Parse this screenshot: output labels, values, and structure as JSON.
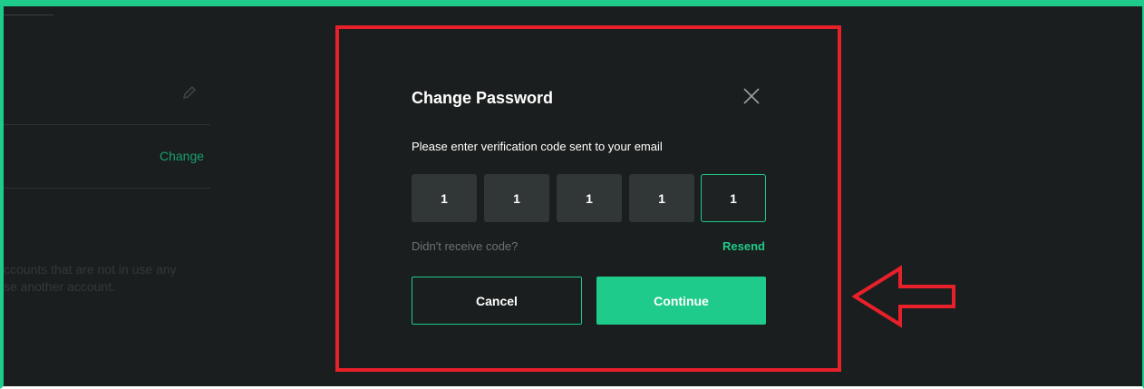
{
  "background": {
    "change_link": "Change",
    "note_line_1": "ccounts that are not in use any",
    "note_line_2": "se another account."
  },
  "modal": {
    "title": "Change Password",
    "subtitle": "Please enter verification code sent to your email",
    "code_digits": [
      "1",
      "1",
      "1",
      "1",
      "1"
    ],
    "didnt_receive": "Didn't receive code?",
    "resend_label": "Resend",
    "cancel_label": "Cancel",
    "continue_label": "Continue"
  },
  "icons": {
    "close": "close-icon",
    "edit": "pencil-icon",
    "annotation_arrow": "arrow-left-icon"
  },
  "colors": {
    "accent": "#1ecb8a",
    "background": "#1b1e1e",
    "input_bg": "#313636",
    "annotation": "#e8202a"
  }
}
